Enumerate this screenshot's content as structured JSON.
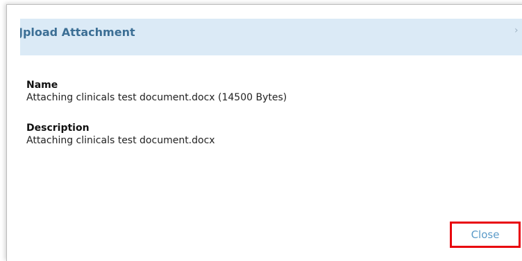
{
  "dialog": {
    "title": "Jpload Attachment",
    "close_icon_glyph": "›",
    "fields": [
      {
        "label": "Name",
        "value": "Attaching clinicals test document.docx (14500 Bytes)"
      },
      {
        "label": "Description",
        "value": "Attaching clinicals test document.docx"
      }
    ],
    "close_button_label": "Close"
  },
  "colors": {
    "header_bg": "#dbeaf6",
    "title": "#3c6f95",
    "close_link": "#5a9ac8",
    "highlight_border": "#e8000b"
  }
}
